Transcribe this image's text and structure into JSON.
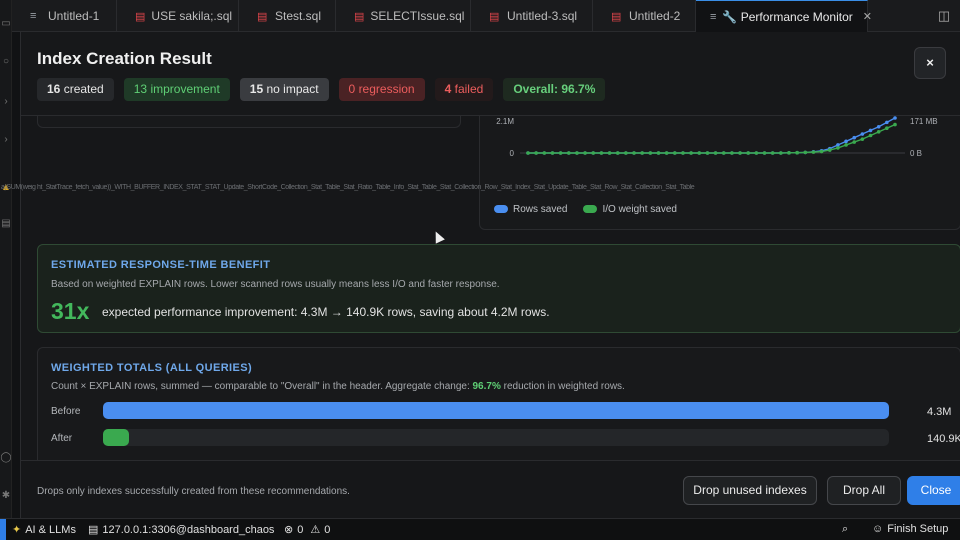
{
  "tabs": [
    {
      "label": "Untitled-1",
      "icon": "document-icon"
    },
    {
      "label": "USE sakila;.sql",
      "icon": "database-icon"
    },
    {
      "label": "Stest.sql",
      "icon": "database-icon"
    },
    {
      "label": "SELECTIssue.sql",
      "icon": "database-icon"
    },
    {
      "label": "Untitled-3.sql",
      "icon": "database-icon"
    },
    {
      "label": "Untitled-2",
      "icon": "database-icon"
    },
    {
      "label": "🔧 Performance Monitor",
      "icon": "document-icon",
      "active": true
    }
  ],
  "dialog": {
    "title": "Index Creation Result",
    "pills": {
      "created": {
        "count": "16",
        "label": "created"
      },
      "improvement": {
        "count": "13",
        "label": "improvement"
      },
      "no_impact": {
        "count": "15",
        "label": "no impact"
      },
      "regression": {
        "count": "0",
        "label": "regression"
      },
      "failed": {
        "count": "4",
        "label": "failed"
      },
      "overall": {
        "label": "Overall:",
        "value": "96.7%"
      }
    },
    "close_label": "×"
  },
  "chart_data": {
    "type": "line",
    "y_left_ticks": [
      "2.1M",
      "0"
    ],
    "y_right_ticks": [
      "171 MB",
      "0 B"
    ],
    "legend_position": "bottom-left",
    "series": [
      {
        "name": "Rows saved",
        "color": "#4a8ef0",
        "values": [
          0,
          0,
          0,
          0,
          0,
          0,
          0,
          0,
          0,
          0,
          0,
          0,
          0,
          0,
          0,
          0,
          0,
          0,
          0,
          0,
          0,
          0,
          0,
          0,
          0,
          0,
          0,
          0,
          0,
          0,
          0,
          0,
          0.01,
          0.02,
          0.04,
          0.08,
          0.15,
          0.3,
          0.55,
          0.8,
          1.05,
          1.3,
          1.55,
          1.8,
          2.1,
          2.4
        ]
      },
      {
        "name": "I/O weight saved",
        "color": "#3aa94f",
        "values": [
          0,
          0,
          0,
          0,
          0,
          0,
          0,
          0,
          0,
          0,
          0,
          0,
          0,
          0,
          0,
          0,
          0,
          0,
          0,
          0,
          0,
          0,
          0,
          0,
          0,
          0,
          0,
          0,
          0,
          0,
          0,
          0,
          0.01,
          0.02,
          0.04,
          0.06,
          0.1,
          0.2,
          0.35,
          0.55,
          0.75,
          0.95,
          1.2,
          1.45,
          1.7,
          1.95
        ]
      }
    ]
  },
  "noise_text": "a)SUM(weig ht_StatTrace_fetch_value))_WITH_BUFFER_INDEX_STAT_STAT_Update_ShortCode_Collection_Stat_Table_Stat_Ratio_Table_Info_Stat_Table_Stat_Collection_Row_Stat_Index_Stat_Update_Table_Stat_Row_Stat_Collection_Stat_Table",
  "benefit": {
    "title": "ESTIMATED RESPONSE-TIME BENEFIT",
    "subtitle": "Based on weighted EXPLAIN rows. Lower scanned rows usually means less I/O and faster response.",
    "multiplier": "31x",
    "description": "expected performance improvement: 4.3M → 140.9K rows, saving about 4.2M rows."
  },
  "totals": {
    "title": "WEIGHTED TOTALS (ALL QUERIES)",
    "subtitle_pre": "Count × EXPLAIN rows, summed — comparable to \"Overall\" in the header. Aggregate change: ",
    "subtitle_highlight": "96.7%",
    "subtitle_post": " reduction in weighted rows.",
    "before": {
      "label": "Before",
      "value": "4.3M",
      "fraction": 1.0
    },
    "after": {
      "label": "After",
      "value": "140.9K",
      "fraction": 0.033
    }
  },
  "footer": {
    "note": "Drops only indexes successfully created from these recommendations.",
    "drop_unused": "Drop unused indexes",
    "drop_all": "Drop All",
    "close": "Close"
  },
  "statusbar": {
    "ai": "AI & LLMs",
    "connection": "127.0.0.1:3306@dashboard_chaos",
    "errors": "0",
    "warnings": "0",
    "finish": "Finish Setup"
  },
  "colors": {
    "accent": "#2f7fe8",
    "success": "#3aa94f",
    "danger": "#ec5d5d",
    "info": "#6fa8ea"
  }
}
